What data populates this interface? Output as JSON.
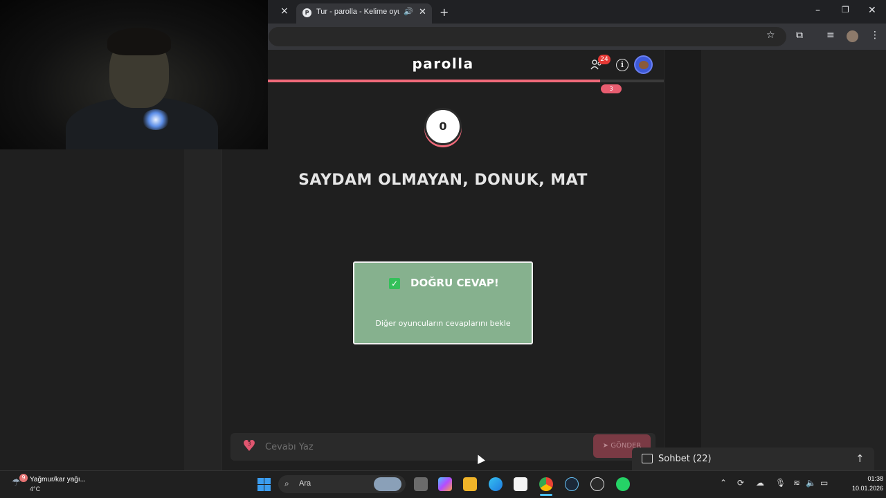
{
  "browser": {
    "tab_title": "Tur - parolla - Kelime oyunu",
    "tab_favicon": "P",
    "prev_tab_close": "×",
    "new_tab": "+"
  },
  "game": {
    "logo": "parolla",
    "players_count": "24",
    "progress_pill": "3",
    "progress_fraction": 0.84,
    "timer": "0",
    "question": "SAYDAM OLMAYAN, DONUK, MAT",
    "result_title": "DOĞRU CEVAP!",
    "result_subtitle": "Diğer oyuncuların cevaplarını bekle",
    "lives": "3",
    "answer_placeholder": "Cevabı Yaz",
    "send_label": "GÖNDER",
    "chat_label": "Sohbet (22)"
  },
  "taskbar": {
    "weather_text": "Yağmur/kar yağı...",
    "weather_temp": "4°C",
    "weather_badge": "9",
    "search_label": "Ara",
    "time": "01:38",
    "date": "10.01.2026"
  },
  "colors": {
    "accent": "#f06a7a",
    "success": "#86b18e",
    "avatar": "#3d59d8"
  }
}
